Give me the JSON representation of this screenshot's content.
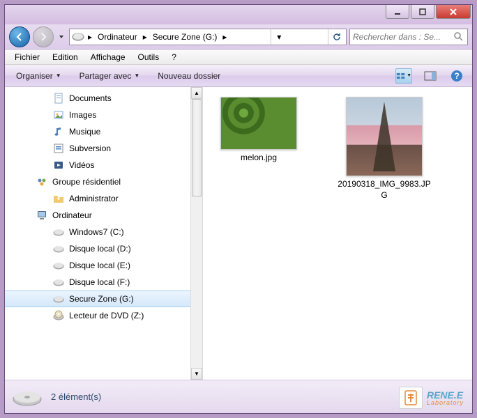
{
  "window": {
    "title": ""
  },
  "nav": {
    "breadcrumbs": [
      "Ordinateur",
      "Secure Zone (G:)"
    ],
    "search_placeholder": "Rechercher dans : Se..."
  },
  "menu": {
    "items": [
      "Fichier",
      "Edition",
      "Affichage",
      "Outils",
      "?"
    ]
  },
  "toolbar": {
    "organize": "Organiser",
    "share": "Partager avec",
    "newfolder": "Nouveau dossier"
  },
  "sidebar": {
    "items": [
      {
        "label": "Documents",
        "icon": "doc",
        "level": 1
      },
      {
        "label": "Images",
        "icon": "img",
        "level": 1
      },
      {
        "label": "Musique",
        "icon": "music",
        "level": 1
      },
      {
        "label": "Subversion",
        "icon": "svn",
        "level": 1
      },
      {
        "label": "Vidéos",
        "icon": "video",
        "level": 1
      },
      {
        "label": "Groupe résidentiel",
        "icon": "homegroup",
        "level": 0
      },
      {
        "label": "Administrator",
        "icon": "user",
        "level": 1
      },
      {
        "label": "Ordinateur",
        "icon": "computer",
        "level": 0
      },
      {
        "label": "Windows7 (C:)",
        "icon": "drive",
        "level": 1
      },
      {
        "label": "Disque local (D:)",
        "icon": "drive",
        "level": 1
      },
      {
        "label": "Disque local (E:)",
        "icon": "drive",
        "level": 1
      },
      {
        "label": "Disque local (F:)",
        "icon": "drive",
        "level": 1
      },
      {
        "label": "Secure Zone (G:)",
        "icon": "drive",
        "level": 1,
        "selected": true
      },
      {
        "label": "Lecteur de DVD (Z:)",
        "icon": "dvd",
        "level": 1
      }
    ]
  },
  "content": {
    "items": [
      {
        "label": "melon.jpg",
        "thumb": "melon"
      },
      {
        "label": "20190318_IMG_9983.JPG",
        "thumb": "eiffel"
      }
    ]
  },
  "status": {
    "text": "2 élément(s)"
  },
  "branding": {
    "line1": "RENE.E",
    "line2": "Laboratory"
  }
}
